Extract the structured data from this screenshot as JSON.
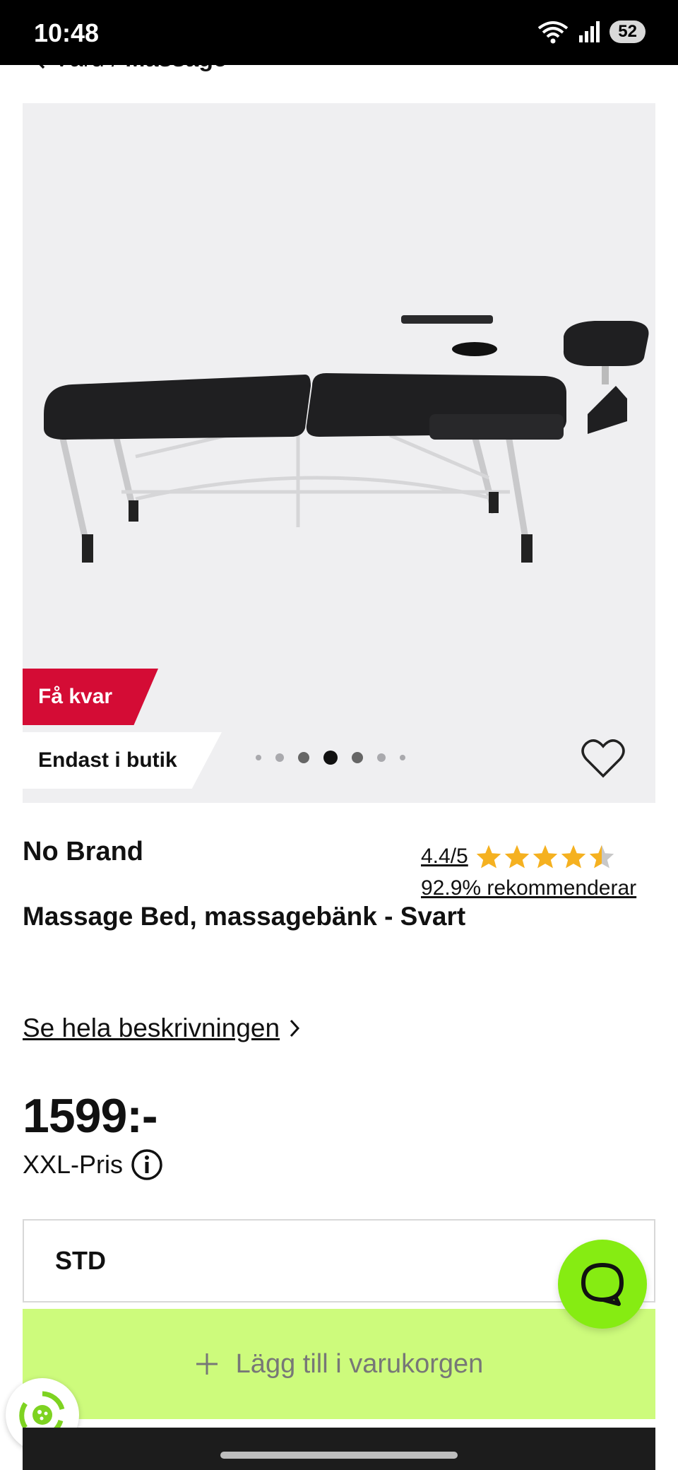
{
  "status_bar": {
    "time": "10:48",
    "battery": "52"
  },
  "breadcrumb": {
    "parent": "Vård",
    "separator": "/",
    "current": "Massage"
  },
  "gallery": {
    "badges": {
      "few_left": "Få kvar",
      "store_only": "Endast i butik"
    },
    "dots_total": 7,
    "active_dot_index": 3
  },
  "product": {
    "brand": "No Brand",
    "name": "Massage Bed, massagebänk - Svart",
    "rating_text": "4.4/5",
    "rating_value": 4.4,
    "rating_max": 5,
    "recommend_text": "92.9% rekommenderar",
    "description_link": "Se hela beskrivningen",
    "price": "1599:-",
    "price_label": "XXL-Pris"
  },
  "variant": {
    "selected": "STD"
  },
  "cart": {
    "add_label": "Lägg till i varukorgen"
  },
  "colors": {
    "accent_red": "#d40c35",
    "cart_green": "#cdfb7c",
    "chat_green": "#86ec12",
    "star": "#f5b120"
  },
  "icons": {
    "back": "chevron-left-icon",
    "favorite": "heart-icon",
    "info": "info-icon",
    "chat": "chat-icon",
    "add": "plus-icon",
    "widget": "recycle-icon"
  }
}
